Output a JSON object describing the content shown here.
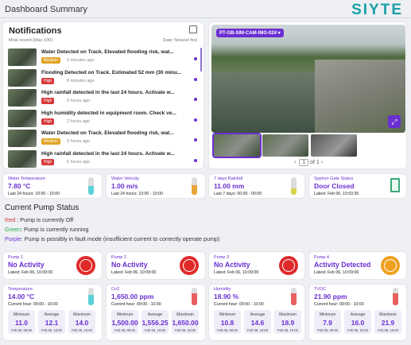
{
  "header": {
    "title": "Dashboard Summary",
    "logo": "SIYTE"
  },
  "notifications": {
    "title": "Notifications",
    "subtitle": "Most recent (Max 100)",
    "sort": "Date: Newest first",
    "items": [
      {
        "msg": "Water Detected on Track. Elevated flooding risk, wat...",
        "sev": "Medium",
        "time": "3 minutes ago"
      },
      {
        "msg": "Flooding Detected on Track. Estimated 52 mm (30 minu...",
        "sev": "High",
        "time": "8 minutes ago"
      },
      {
        "msg": "High rainfall detected in the last 24 hours. Activate w...",
        "sev": "High",
        "time": "2 hours ago"
      },
      {
        "msg": "High humidity detected in equipment room. Check ve...",
        "sev": "High",
        "time": "2 hours ago"
      },
      {
        "msg": "Water Detected on Track. Elevated flooding risk, wat...",
        "sev": "Medium",
        "time": "3 hours ago"
      },
      {
        "msg": "High rainfall detected in the last 24 hours. Activate w...",
        "sev": "High",
        "time": "6 hours ago"
      }
    ]
  },
  "camera": {
    "tag": "PT-GB-SIM-CAM-IMG-024 ▾",
    "page": "1",
    "of": "of 1",
    "prev": "‹",
    "next": "›"
  },
  "sensors": [
    {
      "label": "Water Temperature",
      "value": "7.80 °C",
      "meta": "Last 24 hours: 10:00 - 10:00",
      "color": "#5ad0d8",
      "level": 0.5
    },
    {
      "label": "Water Velocity",
      "value": "1.00 m/s",
      "meta": "Last 24 hours: 10:00 - 10:00",
      "color": "#e8a53a",
      "level": 0.55
    },
    {
      "label": "7 days Rainfall",
      "value": "11.00 mm",
      "meta": "Last 7 days: 00:00 - 00:00",
      "color": "#d8d44a",
      "level": 0.35
    },
    {
      "label": "Syphon Gate Status",
      "value": "Door Closed",
      "meta": "Latest: Feb 06, 10:03:35"
    }
  ],
  "pump_section": {
    "title": "Current Pump Status",
    "legend": [
      {
        "key": "Red",
        "text": " : Pump is currently Off",
        "color": "#d93838"
      },
      {
        "key": "Green",
        "text": ": Pump is currently running",
        "color": "#2aa84a"
      },
      {
        "key": "Purple",
        "text": ": Pump is possibly in fault mode (insufficient current to correctly operate pump)",
        "color": "#6a2fd1"
      }
    ]
  },
  "pumps": [
    {
      "label": "Pump 1",
      "status": "No Activity",
      "meta": "Latest: Feb 06, 10:09:00",
      "color": "#e02a2a"
    },
    {
      "label": "Pump 2",
      "status": "No Activity",
      "meta": "Latest: Feb 06, 10:09:00",
      "color": "#e02a2a"
    },
    {
      "label": "Pump 3",
      "status": "No Activity",
      "meta": "Latest: Feb 06, 10:09:00",
      "color": "#e02a2a"
    },
    {
      "label": "Pump 4",
      "status": "Activity Detected",
      "meta": "Latest: Feb 06, 10:09:00",
      "color": "#f0a020"
    }
  ],
  "env": [
    {
      "label": "Temperature",
      "value": "14.00 °C",
      "meta": "Current hour: 09:00 - 10:00",
      "color": "#5ad0d8",
      "level": 0.6,
      "stats": [
        {
          "k": "Minimum",
          "v": "11.0",
          "d": "Feb 06, 09:30"
        },
        {
          "k": "Average",
          "v": "12.1",
          "d": "Feb 06, 10:00"
        },
        {
          "k": "Maximum",
          "v": "14.0",
          "d": "Feb 06, 10:00"
        }
      ]
    },
    {
      "label": "Co2",
      "value": "1,650.00 ppm",
      "meta": "Current hour: 09:00 - 10:00",
      "color": "#e86060",
      "level": 0.7,
      "stats": [
        {
          "k": "Minimum",
          "v": "1,500.00",
          "d": "Feb 06, 09:30"
        },
        {
          "k": "Average",
          "v": "1,556.25",
          "d": "Feb 06, 10:00"
        },
        {
          "k": "Maximum",
          "v": "1,650.00",
          "d": "Feb 06, 10:00"
        }
      ]
    },
    {
      "label": "Humidity",
      "value": "18.90 %",
      "meta": "Current hour: 09:00 - 10:00",
      "color": "#e86060",
      "level": 0.7,
      "stats": [
        {
          "k": "Minimum",
          "v": "10.8",
          "d": "Feb 06, 09:30"
        },
        {
          "k": "Average",
          "v": "14.6",
          "d": "Feb 06, 10:00"
        },
        {
          "k": "Maximum",
          "v": "18.9",
          "d": "Feb 06, 10:00"
        }
      ]
    },
    {
      "label": "TVOC",
      "value": "21.90 ppm",
      "meta": "Current hour: 09:00 - 10:00",
      "color": "#e86060",
      "level": 0.7,
      "stats": [
        {
          "k": "Minimum",
          "v": "7.9",
          "d": "Feb 06, 09:30"
        },
        {
          "k": "Average",
          "v": "16.0",
          "d": "Feb 06, 10:00"
        },
        {
          "k": "Maximum",
          "v": "21.9",
          "d": "Feb 06, 10:00"
        }
      ]
    }
  ]
}
